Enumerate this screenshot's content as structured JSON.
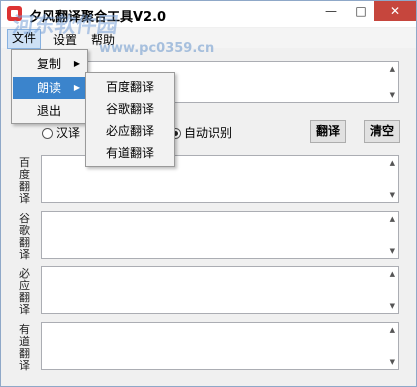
{
  "window": {
    "title": "夕风翻译聚合工具V2.0",
    "controls": {
      "minimize": "—",
      "maximize": "□",
      "close": "✕"
    }
  },
  "watermark": {
    "text": "河东软件园",
    "url": "www.pc0359.cn"
  },
  "menubar": {
    "file": "文件",
    "settings": "设置",
    "help": "帮助"
  },
  "file_menu": {
    "items": [
      {
        "label": "复制",
        "has_submenu": true
      },
      {
        "label": "朗读",
        "has_submenu": true,
        "active": true
      },
      {
        "label": "退出",
        "has_submenu": false
      }
    ]
  },
  "read_submenu": {
    "items": [
      "百度翻译",
      "谷歌翻译",
      "必应翻译",
      "有道翻译"
    ]
  },
  "options": {
    "radio_left": "汉译",
    "radio_right": "自动识别",
    "selected": "自动识别"
  },
  "buttons": {
    "translate": "翻译",
    "clear": "清空"
  },
  "results": [
    {
      "label": "百度翻译",
      "text": ""
    },
    {
      "label": "谷歌翻译",
      "text": ""
    },
    {
      "label": "必应翻译",
      "text": ""
    },
    {
      "label": "有道翻译",
      "text": ""
    }
  ],
  "colors": {
    "menu_highlight": "#3b84cc",
    "close_button": "#c6463d"
  }
}
